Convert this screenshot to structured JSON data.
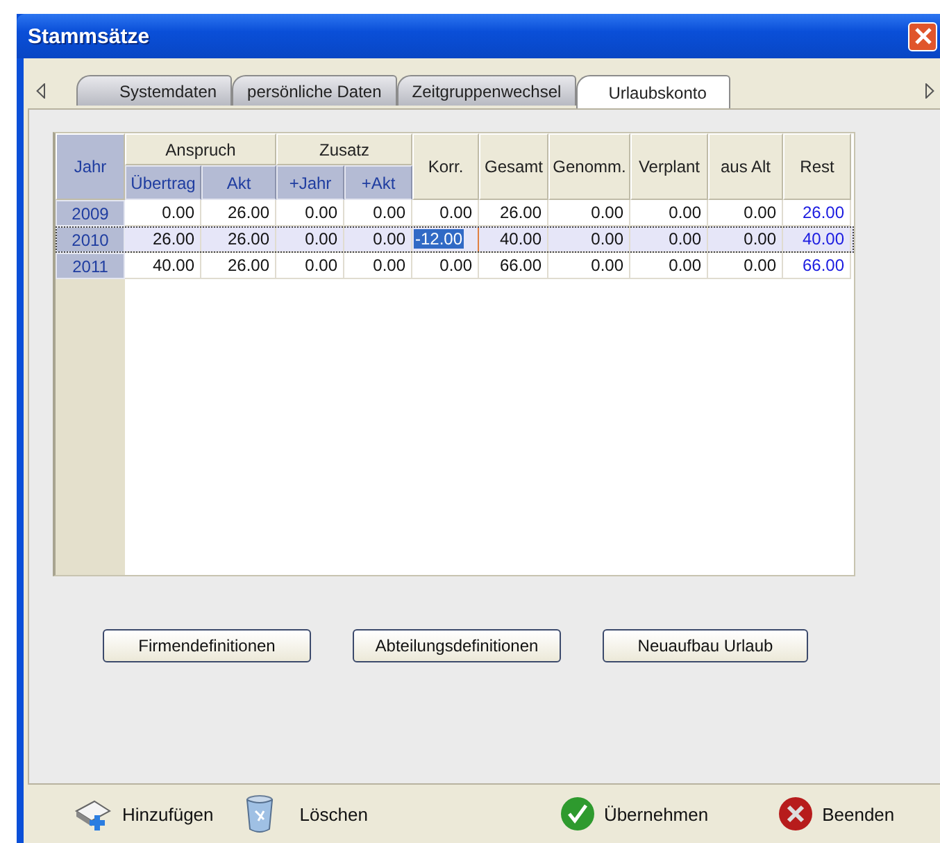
{
  "window": {
    "title": "Stammsätze"
  },
  "tabs": [
    {
      "label": "Systemdaten",
      "selected": false
    },
    {
      "label": "persönliche Daten",
      "selected": false
    },
    {
      "label": "Zeitgruppenwechsel",
      "selected": false
    },
    {
      "label": "Urlaubskonto",
      "selected": true
    }
  ],
  "table": {
    "columns": [
      {
        "label": "Jahr",
        "kind": "year"
      },
      {
        "label": "Übertrag",
        "kind": "sub",
        "group": "Anspruch"
      },
      {
        "label": "Akt",
        "kind": "sub"
      },
      {
        "label": "+Jahr",
        "kind": "sub",
        "group": "Zusatz"
      },
      {
        "label": "+Akt",
        "kind": "sub"
      },
      {
        "label": "Korr.",
        "kind": "number"
      },
      {
        "label": "Gesamt",
        "kind": "number"
      },
      {
        "label": "Genomm.",
        "kind": "number"
      },
      {
        "label": "Verplant",
        "kind": "number"
      },
      {
        "label": "aus Alt",
        "kind": "number"
      },
      {
        "label": "Rest",
        "kind": "balance"
      }
    ],
    "rows": [
      {
        "selected": false,
        "cells": [
          {
            "value": "2009",
            "editing": false
          },
          {
            "value": "0.00",
            "editing": false
          },
          {
            "value": "26.00",
            "editing": false
          },
          {
            "value": "0.00",
            "editing": false
          },
          {
            "value": "0.00",
            "editing": false
          },
          {
            "value": "0.00",
            "editing": false
          },
          {
            "value": "26.00",
            "editing": false
          },
          {
            "value": "0.00",
            "editing": false
          },
          {
            "value": "0.00",
            "editing": false
          },
          {
            "value": "0.00",
            "editing": false
          },
          {
            "value": "26.00",
            "editing": false
          }
        ]
      },
      {
        "selected": true,
        "cells": [
          {
            "value": "2010",
            "editing": false
          },
          {
            "value": "26.00",
            "editing": false
          },
          {
            "value": "26.00",
            "editing": false
          },
          {
            "value": "0.00",
            "editing": false
          },
          {
            "value": "0.00",
            "editing": false
          },
          {
            "value": "-12.00",
            "editing": true
          },
          {
            "value": "40.00",
            "editing": false
          },
          {
            "value": "0.00",
            "editing": false
          },
          {
            "value": "0.00",
            "editing": false
          },
          {
            "value": "0.00",
            "editing": false
          },
          {
            "value": "40.00",
            "editing": false
          }
        ]
      },
      {
        "selected": false,
        "cells": [
          {
            "value": "2011",
            "editing": false
          },
          {
            "value": "40.00",
            "editing": false
          },
          {
            "value": "26.00",
            "editing": false
          },
          {
            "value": "0.00",
            "editing": false
          },
          {
            "value": "0.00",
            "editing": false
          },
          {
            "value": "0.00",
            "editing": false
          },
          {
            "value": "66.00",
            "editing": false
          },
          {
            "value": "0.00",
            "editing": false
          },
          {
            "value": "0.00",
            "editing": false
          },
          {
            "value": "0.00",
            "editing": false
          },
          {
            "value": "66.00",
            "editing": false
          }
        ]
      }
    ]
  },
  "buttons": [
    "Firmendefinitionen",
    "Abteilungsdefinitionen",
    "Neuaufbau Urlaub"
  ],
  "toolbar": [
    {
      "label": "Hinzufügen",
      "kind": "add"
    },
    {
      "label": "Löschen",
      "kind": "delete"
    },
    {
      "label": "Übernehmen",
      "kind": "apply"
    },
    {
      "label": "Beenden",
      "kind": "quit"
    }
  ]
}
